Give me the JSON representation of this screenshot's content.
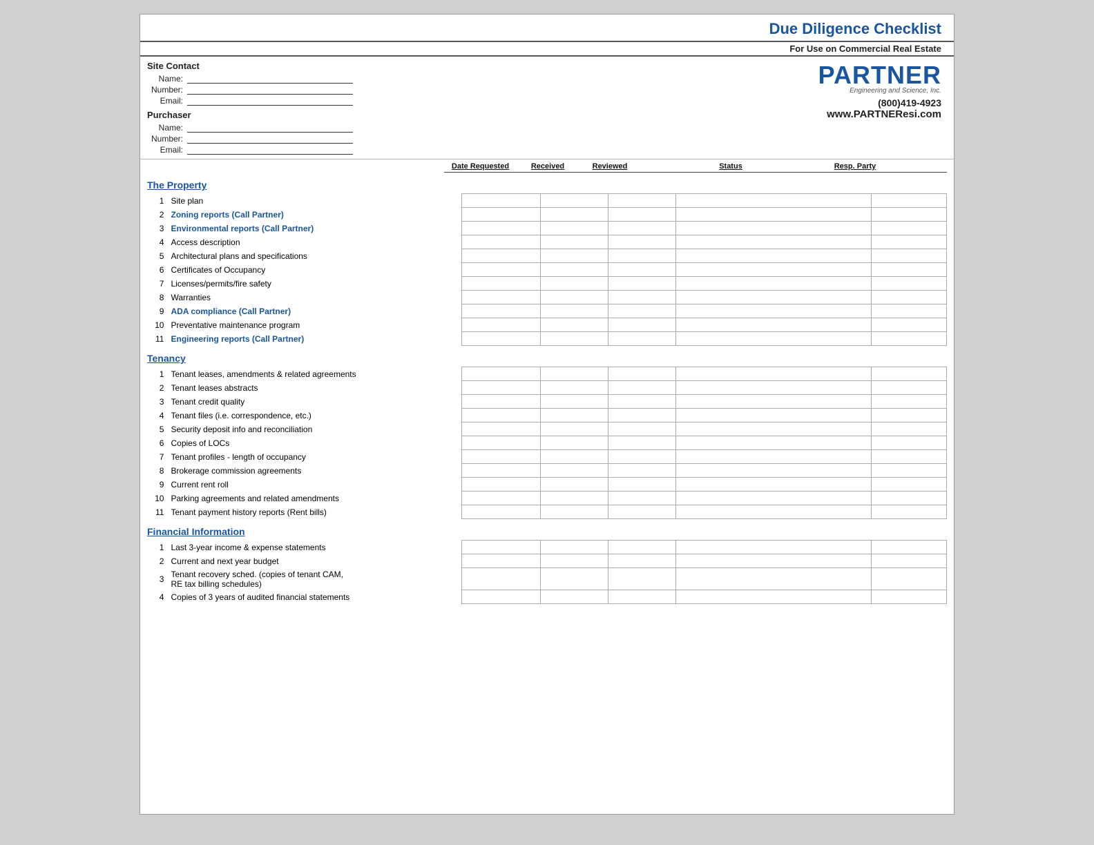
{
  "header": {
    "main_title": "Due Diligence Checklist",
    "subtitle": "For Use on Commercial Real Estate"
  },
  "partner": {
    "logo": "PARTNER",
    "logo_sub": "Engineering and Science, Inc.",
    "phone": "(800)419-4923",
    "website": "www.PARTNEResi.com"
  },
  "site_contact": {
    "label": "Site Contact",
    "name_label": "Name:",
    "number_label": "Number:",
    "email_label": "Email:"
  },
  "purchaser": {
    "label": "Purchaser",
    "name_label": "Name:",
    "number_label": "Number:",
    "email_label": "Email:"
  },
  "columns": {
    "date_requested": "Date Requested",
    "received": "Received",
    "reviewed": "Reviewed",
    "status": "Status",
    "resp_party": "Resp. Party"
  },
  "sections": [
    {
      "id": "property",
      "heading": "The Property",
      "items": [
        {
          "num": 1,
          "text": "Site plan",
          "blue": false
        },
        {
          "num": 2,
          "text": "Zoning reports (Call Partner)",
          "blue": true
        },
        {
          "num": 3,
          "text": "Environmental reports (Call Partner)",
          "blue": true
        },
        {
          "num": 4,
          "text": "Access description",
          "blue": false
        },
        {
          "num": 5,
          "text": "Architectural plans and specifications",
          "blue": false
        },
        {
          "num": 6,
          "text": "Certificates of Occupancy",
          "blue": false
        },
        {
          "num": 7,
          "text": "Licenses/permits/fire safety",
          "blue": false
        },
        {
          "num": 8,
          "text": "Warranties",
          "blue": false
        },
        {
          "num": 9,
          "text": "ADA compliance (Call Partner)",
          "blue": true
        },
        {
          "num": 10,
          "text": "Preventative maintenance program",
          "blue": false
        },
        {
          "num": 11,
          "text": "Engineering reports (Call Partner)",
          "blue": true
        }
      ]
    },
    {
      "id": "tenancy",
      "heading": "Tenancy",
      "items": [
        {
          "num": 1,
          "text": "Tenant leases, amendments & related agreements",
          "blue": false
        },
        {
          "num": 2,
          "text": "Tenant leases abstracts",
          "blue": false
        },
        {
          "num": 3,
          "text": "Tenant credit quality",
          "blue": false
        },
        {
          "num": 4,
          "text": "Tenant files (i.e. correspondence, etc.)",
          "blue": false
        },
        {
          "num": 5,
          "text": "Security deposit info and reconciliation",
          "blue": false
        },
        {
          "num": 6,
          "text": "Copies of LOCs",
          "blue": false
        },
        {
          "num": 7,
          "text": "Tenant profiles - length of occupancy",
          "blue": false
        },
        {
          "num": 8,
          "text": "Brokerage commission agreements",
          "blue": false
        },
        {
          "num": 9,
          "text": "Current rent roll",
          "blue": false
        },
        {
          "num": 10,
          "text": "Parking agreements and related amendments",
          "blue": false
        },
        {
          "num": 11,
          "text": "Tenant payment history reports (Rent bills)",
          "blue": false
        }
      ]
    },
    {
      "id": "financial",
      "heading": "Financial Information",
      "items": [
        {
          "num": 1,
          "text": "Last 3-year income & expense statements",
          "blue": false
        },
        {
          "num": 2,
          "text": "Current and next year budget",
          "blue": false
        },
        {
          "num": 3,
          "text": "Tenant recovery sched. (copies of tenant CAM,\nRE tax billing schedules)",
          "blue": false,
          "multiline": true
        },
        {
          "num": 4,
          "text": "Copies of 3 years of audited financial statements",
          "blue": false
        }
      ]
    }
  ]
}
